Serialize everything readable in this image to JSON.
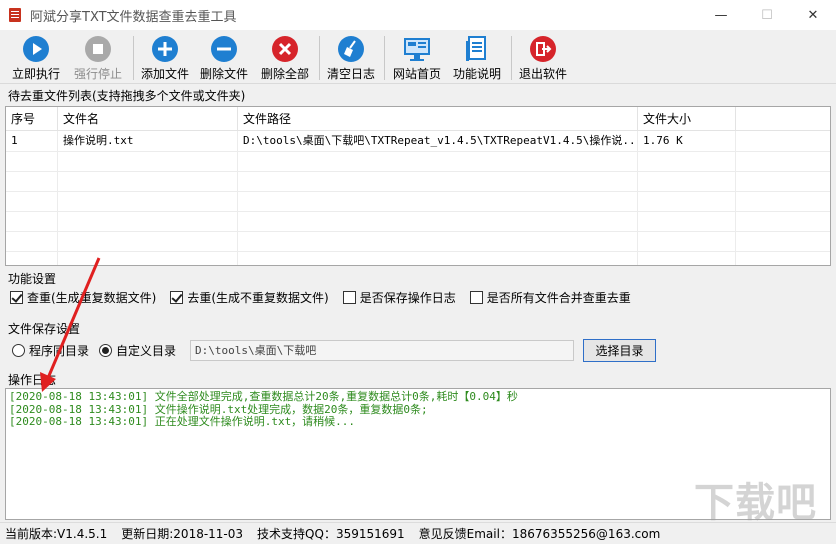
{
  "window": {
    "title": "阿斌分享TXT文件数据查重去重工具",
    "minimize": "—",
    "maximize": "☐",
    "close": "✕"
  },
  "toolbar": [
    {
      "label": "立即执行",
      "icon": "play-icon",
      "color": "#1f7fd1",
      "enabled": true
    },
    {
      "label": "强行停止",
      "icon": "stop-icon",
      "color": "#a9a9a9",
      "enabled": false
    },
    {
      "label": "添加文件",
      "icon": "plus-icon",
      "color": "#1f7fd1",
      "enabled": true
    },
    {
      "label": "删除文件",
      "icon": "minus-icon",
      "color": "#1f7fd1",
      "enabled": true
    },
    {
      "label": "删除全部",
      "icon": "close-circle-icon",
      "color": "#d6242a",
      "enabled": true
    },
    {
      "label": "清空日志",
      "icon": "broom-icon",
      "color": "#1f7fd1",
      "enabled": true
    },
    {
      "label": "网站首页",
      "icon": "monitor-icon",
      "color": "#1f7fd1",
      "enabled": true
    },
    {
      "label": "功能说明",
      "icon": "document-icon",
      "color": "#1f7fd1",
      "enabled": true
    },
    {
      "label": "退出软件",
      "icon": "exit-icon",
      "color": "#d6242a",
      "enabled": true
    }
  ],
  "file_list": {
    "title": "待去重文件列表(支持拖拽多个文件或文件夹)",
    "columns": [
      "序号",
      "文件名",
      "文件路径",
      "文件大小"
    ],
    "rows": [
      [
        "1",
        "操作说明.txt",
        "D:\\tools\\桌面\\下载吧\\TXTRepeat_v1.4.5\\TXTRepeatV1.4.5\\操作说...",
        "1.76 K"
      ]
    ]
  },
  "features": {
    "title": "功能设置",
    "options": [
      {
        "label": "查重(生成重复数据文件)",
        "checked": true
      },
      {
        "label": "去重(生成不重复数据文件)",
        "checked": true
      },
      {
        "label": "是否保存操作日志",
        "checked": false
      },
      {
        "label": "是否所有文件合并查重去重",
        "checked": false
      }
    ]
  },
  "save_settings": {
    "title": "文件保存设置",
    "options": [
      {
        "label": "程序同目录",
        "checked": false
      },
      {
        "label": "自定义目录",
        "checked": true
      }
    ],
    "directory": "D:\\tools\\桌面\\下载吧",
    "choose_button": "选择目录"
  },
  "log": {
    "title": "操作日志",
    "lines": [
      "[2020-08-18 13:43:01] 文件全部处理完成,查重数据总计20条,重复数据总计0条,耗时【0.04】秒",
      "[2020-08-18 13:43:01] 文件操作说明.txt处理完成，数据20条，重复数据0条;",
      "[2020-08-18 13:43:01] 正在处理文件操作说明.txt，请稍候..."
    ]
  },
  "status": {
    "version": "当前版本:V1.4.5.1",
    "update_date": "更新日期:2018-11-03",
    "qq": "技术支持QQ：359151691",
    "feedback": "意见反馈Email：18676355256@163.com"
  },
  "watermark": "下载吧",
  "colors": {
    "accent_blue": "#1f7fd1",
    "danger_red": "#d6242a",
    "log_green": "#2e8b1e",
    "arrow_red": "#e02020"
  }
}
